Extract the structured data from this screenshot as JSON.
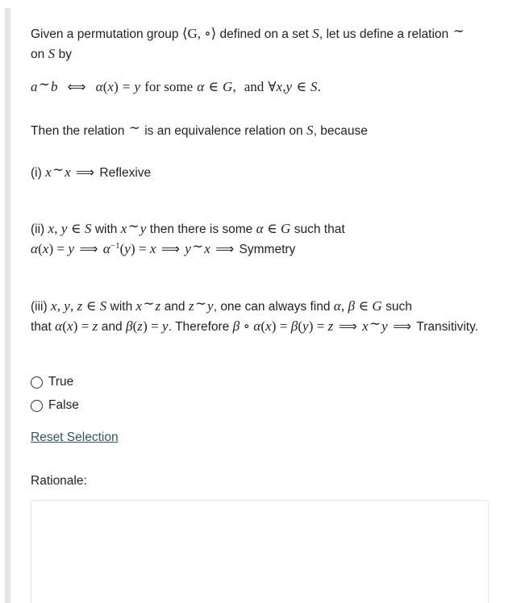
{
  "question": {
    "intro": {
      "line1_a": "Given a permutation group ",
      "math_group": "⟨G, ∘⟩",
      "line1_b": " defined on a set ",
      "math_S": "S",
      "line1_c": ", let us define a relation ",
      "math_tilde": "∼",
      "line1_d": " on ",
      "math_S2": "S",
      "line1_e": " by"
    },
    "display_equation": {
      "lhs_a": "a",
      "lhs_tilde": "∼",
      "lhs_b": "b",
      "iff": "⟺",
      "alpha": "α",
      "open": "(",
      "x": "x",
      "close": ")",
      "eq": "=",
      "y": "y",
      "for_some": "for some",
      "alpha2": "α",
      "in": "∈",
      "G": "G",
      "comma": ",",
      "and": "and",
      "forall": "∀",
      "x2": "x",
      "comma2": ",",
      "y2": "y",
      "in2": "∈",
      "S": "S",
      "period": "."
    },
    "then_line": {
      "a": "Then the relation ",
      "tilde": "∼",
      "b": " is an equivalence relation on ",
      "S": "S",
      "c": ", because"
    },
    "items": [
      {
        "id": "item-i",
        "marker": "(i)",
        "x1": "x",
        "tilde": "∼",
        "x2": "x",
        "arrow": "⟹",
        "conclusion": "Reflexive"
      },
      {
        "id": "item-ii",
        "marker": "(ii)",
        "x": "x",
        "comma": ",",
        "y": "y",
        "in": "∈",
        "S": "S",
        "with": "with",
        "x_b": "x",
        "tilde": "∼",
        "y_b": "y",
        "then_there_is_some": "then there is some",
        "alpha": "α",
        "in2": "∈",
        "G": "G",
        "such_that": "such that",
        "alpha2": "α",
        "open": "(",
        "x_c": "x",
        "close": ")",
        "eq": "=",
        "y_c": "y",
        "arrow1": "⟹",
        "alpha_inv": "α",
        "inv_sup": "−1",
        "open2": "(",
        "y_d": "y",
        "close2": ")",
        "eq2": "=",
        "x_d": "x",
        "arrow2": "⟹",
        "y_e": "y",
        "tilde2": "∼",
        "x_e": "x",
        "arrow3": "⟹",
        "conclusion": "Symmetry"
      },
      {
        "id": "item-iii",
        "marker": "(iii)",
        "x": "x",
        "c1": ",",
        "y": "y",
        "c2": ",",
        "z": "z",
        "in": "∈",
        "S": "S",
        "with": "with",
        "x_b": "x",
        "tilde1": "∼",
        "z_b": "z",
        "and1": "and",
        "z_c": "z",
        "tilde2": "∼",
        "y_b": "y",
        "rest1": ", one can always find",
        "alpha": "α",
        "c3": ",",
        "beta": "β",
        "in2": "∈",
        "G": "G",
        "such_that": "such that",
        "alpha2": "α",
        "o1": "(",
        "x_c": "x",
        "cl1": ")",
        "eq1": "=",
        "z_d": "z",
        "and2": "and",
        "beta2": "β",
        "o2": "(",
        "z_e": "z",
        "cl2": ")",
        "eq2": "=",
        "y_c": "y",
        "therefore": ". Therefore",
        "beta3": "β",
        "circ": "∘",
        "alpha3": "α",
        "o3": "(",
        "x_d": "x",
        "cl3": ")",
        "eq3": "=",
        "beta4": "β",
        "o4": "(",
        "y_d": "y",
        "cl4": ")",
        "eq4": "=",
        "z_f": "z",
        "arrow1": "⟹",
        "x_e": "x",
        "tilde3": "∼",
        "y_e": "y",
        "arrow2": "⟹",
        "conclusion": "Transitivity."
      }
    ]
  },
  "answer_options": [
    {
      "label": "True",
      "selected": false
    },
    {
      "label": "False",
      "selected": false
    }
  ],
  "reset_link_label": "Reset Selection",
  "rationale": {
    "label": "Rationale:",
    "value": "",
    "placeholder": ""
  },
  "colors": {
    "text": "#232323",
    "link": "#35545e",
    "rail": "#e2e4e5",
    "input_border": "#e3e3e3",
    "radio_border": "#2f2f2f",
    "background": "#ffffff"
  }
}
